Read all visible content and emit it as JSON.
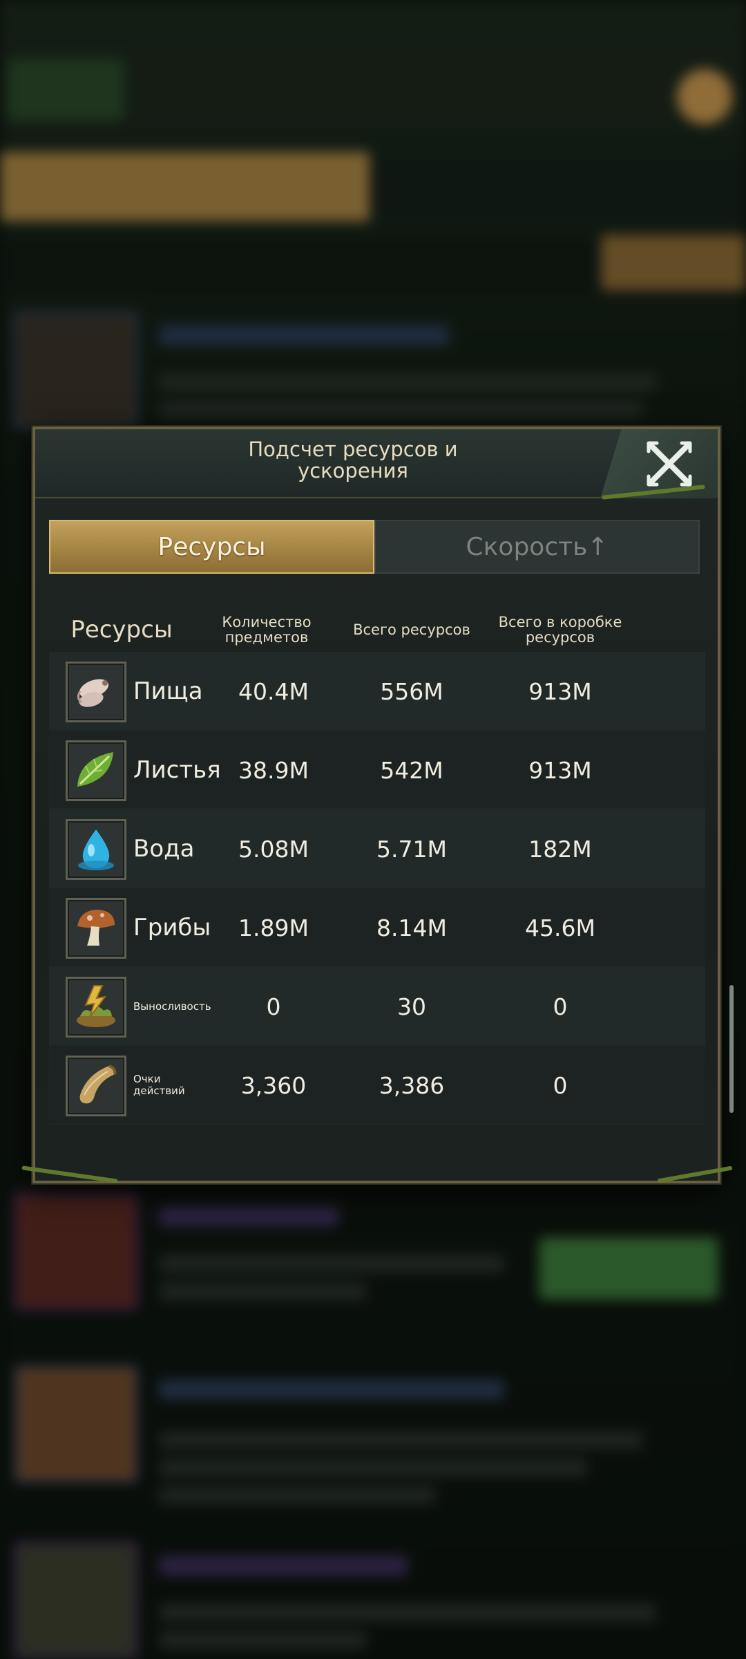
{
  "modal": {
    "title": "Подсчет ресурсов и\nускорения",
    "tabs": [
      {
        "label": "Ресурсы",
        "active": true
      },
      {
        "label": "Скорость↑",
        "active": false
      }
    ],
    "columns": {
      "resources": "Ресурсы",
      "quantity": "Количество\nпредметов",
      "total": "Всего ресурсов",
      "in_box": "Всего в коробке\nресурсов"
    },
    "rows": [
      {
        "icon": "meat-icon",
        "name": "Пища",
        "quantity": "40.4M",
        "total": "556M",
        "in_box": "913M"
      },
      {
        "icon": "leaf-icon",
        "name": "Листья",
        "quantity": "38.9M",
        "total": "542M",
        "in_box": "913M"
      },
      {
        "icon": "water-drop-icon",
        "name": "Вода",
        "quantity": "5.08M",
        "total": "5.71M",
        "in_box": "182M"
      },
      {
        "icon": "mushroom-icon",
        "name": "Грибы",
        "quantity": "1.89M",
        "total": "8.14M",
        "in_box": "45.6M"
      },
      {
        "icon": "stamina-icon",
        "name": "Выносливость",
        "quantity": "0",
        "total": "30",
        "in_box": "0"
      },
      {
        "icon": "horn-icon",
        "name": "Очки\nдействий",
        "quantity": "3,360",
        "total": "3,386",
        "in_box": "0"
      }
    ]
  },
  "colors": {
    "accent_gold": "#a58443",
    "text_light": "#f1ece0",
    "panel_bg": "#1e2523"
  }
}
